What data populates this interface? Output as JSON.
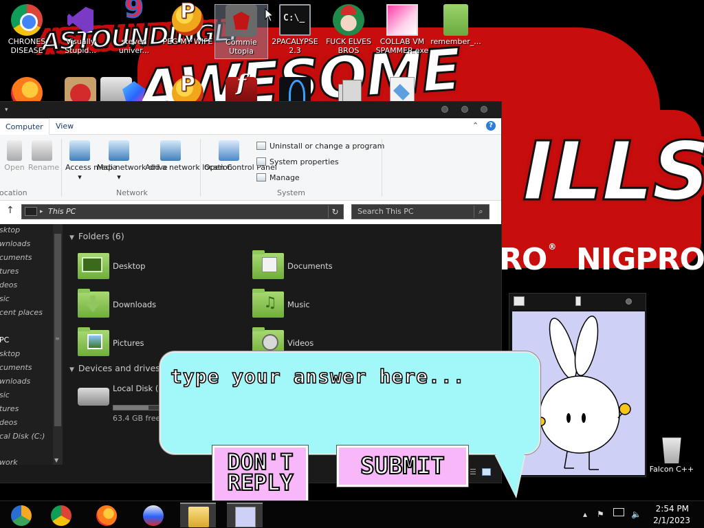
{
  "desktop": {
    "wallpaper": {
      "words": [
        "ASTOUNDINGLY",
        "AWESOME",
        "ILLS"
      ],
      "stamps": [
        "RO",
        "NIGPRO"
      ],
      "stamp_mark": "®"
    },
    "icons_row1": [
      {
        "label": "CHRONES DISEASE",
        "icon": "chrome-icon"
      },
      {
        "label": "Visually Stupid...",
        "icon": "visual-studio-icon"
      },
      {
        "label": "steven univer...",
        "icon": "steven-universe-icon"
      },
      {
        "label": "PEG MY WIFE",
        "icon": "peggle-icon"
      },
      {
        "label": "Commie Utopia",
        "icon": "commie-utopia-icon"
      },
      {
        "label": "2PACALYPSE 2.3",
        "icon": "command-prompt-icon"
      },
      {
        "label": "FUCK ELVES BROS",
        "icon": "elves-icon"
      },
      {
        "label": "COLLAB VM SPAMMER.exe",
        "icon": "collabvm-icon"
      },
      {
        "label": "remember_...",
        "icon": "folder-icon"
      }
    ],
    "icons_row2": [
      "firefox-icon",
      "angry-birds-icon",
      "printer-icon",
      "gem-icon",
      "peggle-icon",
      "flash-icon",
      "blade-icon",
      "stack-icon",
      "document-icon"
    ],
    "recycle_bin": {
      "label": "Falcon C++",
      "icon": "recycle-bin-icon"
    }
  },
  "explorer": {
    "tabs": [
      "Computer",
      "View"
    ],
    "active_tab": "Computer",
    "ribbon": {
      "location_buttons": [
        "Open",
        "Rename"
      ],
      "location_group": "ocation",
      "network_buttons": [
        {
          "label": "Access media",
          "dropdown": "▾"
        },
        {
          "label": "Map network drive",
          "dropdown": "▾"
        },
        {
          "label": "Add a network location"
        }
      ],
      "network_group": "Network",
      "control_panel": "Open Control Panel",
      "system_items": [
        "Uninstall or change a program",
        "System properties",
        "Manage"
      ],
      "system_group": "System"
    },
    "address": {
      "path": "This PC",
      "search_placeholder": "Search This PC"
    },
    "nav_items": [
      "sktop",
      "wnloads",
      "cuments",
      "tures",
      "deos",
      "sic",
      "cent places",
      "PC",
      "sktop",
      "cuments",
      "wnloads",
      "sic",
      "tures",
      "deos",
      "cal Disk (C:)",
      "work"
    ],
    "folders_header": "Folders (6)",
    "folders": [
      "Desktop",
      "Documents",
      "Downloads",
      "Music",
      "Pictures",
      "Videos"
    ],
    "devices_header": "Devices and drives",
    "drive": {
      "name": "Local Disk (C:)",
      "free": "63.4 GB free",
      "used_fraction": 0.65
    }
  },
  "dialog": {
    "answer_placeholder": "type your answer here...",
    "dont_reply_line1": "DON'T",
    "dont_reply_line2": "REPLY",
    "submit_label": "SUBMIT"
  },
  "taskbar": {
    "apps": [
      "chrome-canary-icon",
      "chrome-icon",
      "firefox-icon",
      "gem-icon",
      "file-explorer-icon",
      "bunny-icon"
    ],
    "time": "2:54 PM",
    "date": "2/1/2023"
  }
}
